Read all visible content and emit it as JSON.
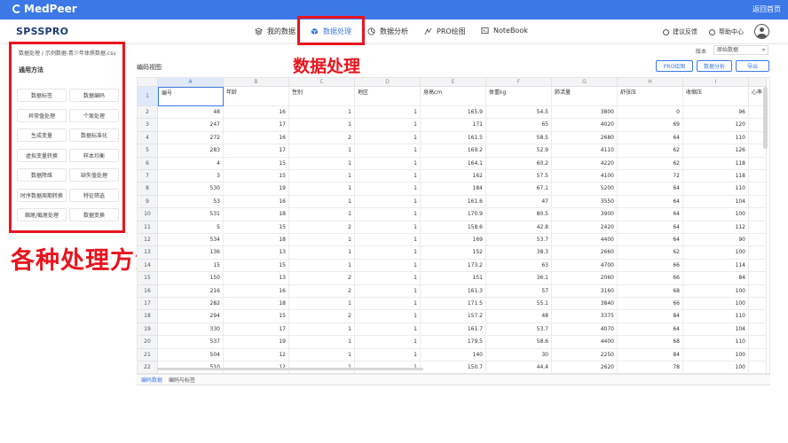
{
  "topbar": {
    "brand": "MedPeer",
    "back_link": "返回首页"
  },
  "nav": {
    "brand": "SPSSPRO",
    "items": [
      {
        "label": "我的数据",
        "icon": "layers-icon"
      },
      {
        "label": "数据处理",
        "icon": "cube-icon",
        "active": true
      },
      {
        "label": "数据分析",
        "icon": "pie-chart-icon"
      },
      {
        "label": "PRO绘图",
        "icon": "pro-chart-icon"
      },
      {
        "label": "NoteBook",
        "icon": "notebook-icon"
      }
    ],
    "feedback": "建议反馈",
    "help": "帮助中心"
  },
  "left": {
    "breadcrumb": "数据处理 / 示例数据-青少年体质数据.csv",
    "section_title": "通用方法",
    "methods": [
      "数据标签",
      "数据编码",
      "异常值处理",
      "个案处理",
      "生成变量",
      "数据标准化",
      "虚拟变量转换",
      "样本均衡",
      "数据降维",
      "缺失值处理",
      "时序数据周期转换",
      "特征筛选",
      "缩尾/截尾处理",
      "数据变换"
    ]
  },
  "annotations": {
    "top": "数据处理",
    "left": "各种处理方法"
  },
  "main": {
    "view_title": "编码视图",
    "version_label": "版本",
    "version_value": "原始数据",
    "buttons": {
      "pro_chart": "PRO绘图",
      "analysis": "数据分析",
      "export": "导出"
    },
    "columns": [
      "A",
      "B",
      "C",
      "D",
      "E",
      "F",
      "G",
      "H",
      "I",
      ""
    ],
    "header_row": [
      "编号",
      "年龄",
      "性别",
      "地区",
      "身高cm",
      "体重kg",
      "肺活量",
      "舒张压",
      "收缩压",
      "心率"
    ],
    "rows": [
      [
        "48",
        "16",
        "1",
        "1",
        "165.9",
        "54.5",
        "3800",
        "0",
        "96",
        ""
      ],
      [
        "247",
        "17",
        "1",
        "1",
        "171",
        "65",
        "4020",
        "69",
        "120",
        ""
      ],
      [
        "272",
        "16",
        "2",
        "1",
        "161.5",
        "58.5",
        "2680",
        "64",
        "110",
        ""
      ],
      [
        "283",
        "17",
        "1",
        "1",
        "169.2",
        "52.9",
        "4110",
        "62",
        "126",
        ""
      ],
      [
        "4",
        "15",
        "1",
        "1",
        "164.1",
        "60.2",
        "4220",
        "62",
        "118",
        ""
      ],
      [
        "3",
        "15",
        "1",
        "1",
        "162",
        "57.5",
        "4100",
        "72",
        "118",
        ""
      ],
      [
        "530",
        "19",
        "1",
        "1",
        "184",
        "67.1",
        "5200",
        "64",
        "110",
        ""
      ],
      [
        "53",
        "16",
        "1",
        "1",
        "161.6",
        "47",
        "3550",
        "64",
        "104",
        ""
      ],
      [
        "531",
        "18",
        "1",
        "1",
        "170.9",
        "80.5",
        "3900",
        "64",
        "100",
        ""
      ],
      [
        "5",
        "15",
        "2",
        "1",
        "158.6",
        "42.8",
        "2420",
        "64",
        "112",
        ""
      ],
      [
        "534",
        "18",
        "1",
        "1",
        "169",
        "53.7",
        "4400",
        "64",
        "90",
        ""
      ],
      [
        "136",
        "13",
        "1",
        "1",
        "152",
        "38.3",
        "2660",
        "62",
        "100",
        ""
      ],
      [
        "15",
        "15",
        "1",
        "1",
        "173.2",
        "63",
        "4700",
        "66",
        "114",
        ""
      ],
      [
        "150",
        "13",
        "2",
        "1",
        "151",
        "36.1",
        "2060",
        "66",
        "84",
        ""
      ],
      [
        "216",
        "16",
        "2",
        "1",
        "161.3",
        "57",
        "3160",
        "68",
        "100",
        ""
      ],
      [
        "282",
        "18",
        "1",
        "1",
        "171.5",
        "55.1",
        "3840",
        "66",
        "100",
        ""
      ],
      [
        "294",
        "15",
        "2",
        "1",
        "157.2",
        "48",
        "3375",
        "84",
        "110",
        ""
      ],
      [
        "330",
        "17",
        "1",
        "1",
        "161.7",
        "53.7",
        "4070",
        "64",
        "104",
        ""
      ],
      [
        "537",
        "19",
        "1",
        "1",
        "179.5",
        "58.6",
        "4400",
        "68",
        "110",
        ""
      ],
      [
        "504",
        "12",
        "1",
        "1",
        "140",
        "30",
        "2250",
        "84",
        "100",
        ""
      ],
      [
        "510",
        "12",
        "1",
        "1",
        "150.7",
        "44.4",
        "2620",
        "78",
        "100",
        ""
      ]
    ],
    "tabs": [
      "编码数据",
      "编码与标签"
    ]
  }
}
